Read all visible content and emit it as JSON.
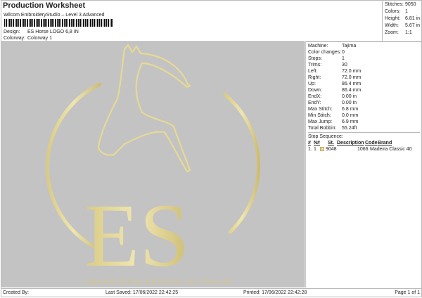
{
  "header": {
    "title": "Production Worksheet",
    "subtitle": "Wilcom EmbroideryStudio – Level 3 Advanced",
    "design_label": "Design:",
    "design_value": "ES Horse LOGO 6,8 IN",
    "colorway_label": "Colorway:",
    "colorway_value": "Colorway 1"
  },
  "stats": [
    {
      "label": "Stitches:",
      "value": "9050"
    },
    {
      "label": "Colors:",
      "value": "1"
    },
    {
      "label": "Height:",
      "value": "6.81 in"
    },
    {
      "label": "Width:",
      "value": "5.67 in"
    },
    {
      "label": "Zoom:",
      "value": "1:1"
    }
  ],
  "details": [
    {
      "label": "Machine:",
      "value": "Tajima"
    },
    {
      "label": "Color changes:",
      "value": "0"
    },
    {
      "label": "Stops:",
      "value": "1"
    },
    {
      "label": "Trims:",
      "value": "30"
    },
    {
      "label": "Left:",
      "value": "72.0 mm"
    },
    {
      "label": "Right:",
      "value": "72.0 mm"
    },
    {
      "label": "Up:",
      "value": "86.4 mm"
    },
    {
      "label": "Down:",
      "value": "86.4 mm"
    },
    {
      "label": "EndX:",
      "value": "0.00 in"
    },
    {
      "label": "EndY:",
      "value": "0.00 in"
    },
    {
      "label": "Max Stitch:",
      "value": "6.8 mm"
    },
    {
      "label": "Min Stitch:",
      "value": "0.0 mm"
    },
    {
      "label": "Max Jump:",
      "value": "6.9 mm"
    },
    {
      "label": "Total Bobbin:",
      "value": "55.24ft"
    }
  ],
  "stop_sequence": {
    "title": "Stop Sequence:",
    "headers": [
      "#",
      "N#",
      "St.",
      "Description",
      "Code",
      "Brand"
    ],
    "rows": [
      {
        "num": "1.",
        "n": "1",
        "color": "#e8d89a",
        "st": "9048",
        "description": "",
        "code": "1066",
        "brand": "Madeira Classic 40"
      }
    ]
  },
  "design": {
    "letters": "ES",
    "tagline": "EQUESTRIAN SERVICE BY DANIEL",
    "thread_color": "#e6d995",
    "background": "#c3c3c3"
  },
  "footer": {
    "created": "Created By:",
    "saved": "Last Saved: 17/06/2022 22:42:25",
    "printed": "Printed: 17/06/2022 22:42:28",
    "page": "Page 1 of 1"
  }
}
